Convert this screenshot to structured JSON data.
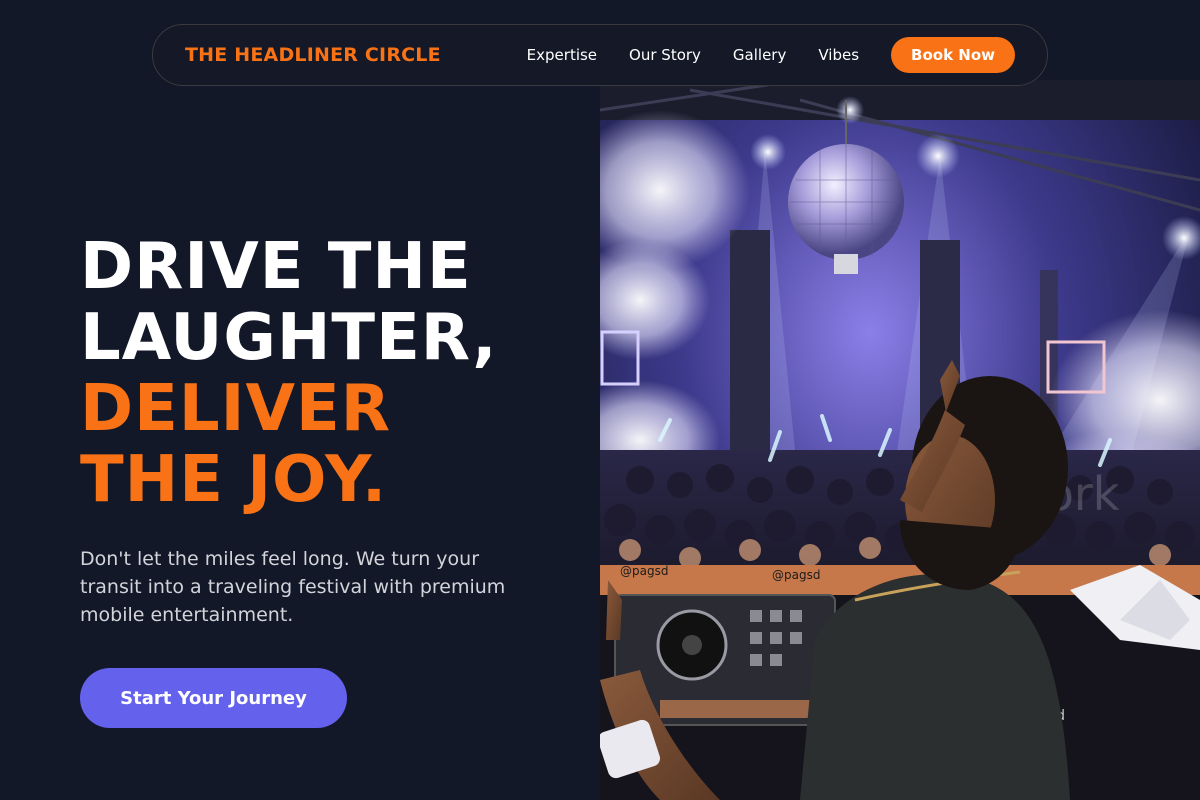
{
  "nav": {
    "brand": "THE HEADLINER CIRCLE",
    "links": [
      "Expertise",
      "Our Story",
      "Gallery",
      "Vibes"
    ],
    "cta_label": "Book Now"
  },
  "hero": {
    "title_line_1": "DRIVE THE",
    "title_line_2": "LAUGHTER,",
    "title_line_3": "DELIVER",
    "title_line_4": "THE JOY.",
    "subtitle": "Don't let the miles feel long. We turn your transit into a traveling festival with premium mobile entertainment.",
    "cta_label": "Start Your Journey",
    "image": {
      "description": "dj-performing-to-nightclub-crowd",
      "deck_label_1": "@pagsd",
      "deck_label_2": "@pagsd",
      "deck_label_3": "qsd",
      "watermark": "ly.work"
    }
  },
  "colors": {
    "background": "#131828",
    "accent_orange": "#f97316",
    "accent_purple": "#6461ed",
    "text_muted": "#d3d4da"
  }
}
